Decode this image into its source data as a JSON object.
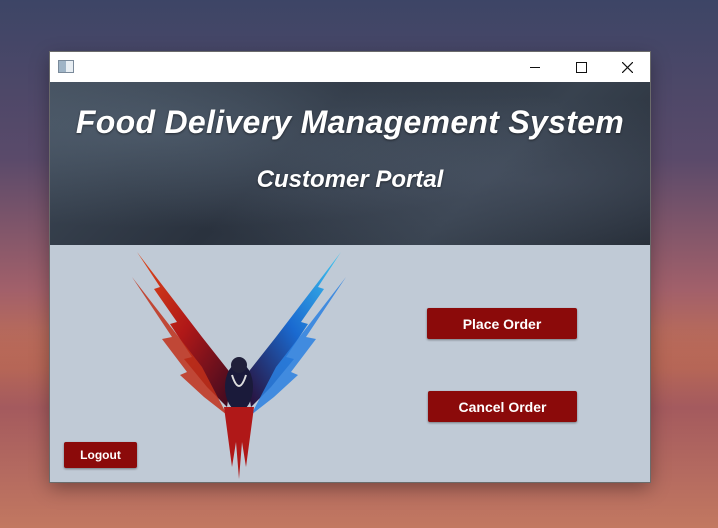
{
  "window": {
    "controls": {
      "minimize": "minimize-icon",
      "maximize": "maximize-icon",
      "close": "close-icon"
    }
  },
  "header": {
    "title": "Food Delivery Management System",
    "subtitle": "Customer Portal"
  },
  "actions": {
    "place_order": "Place Order",
    "cancel_order": "Cancel Order",
    "logout": "Logout"
  },
  "colors": {
    "button": "#8b0a0a",
    "panel": "#c0cad6"
  }
}
